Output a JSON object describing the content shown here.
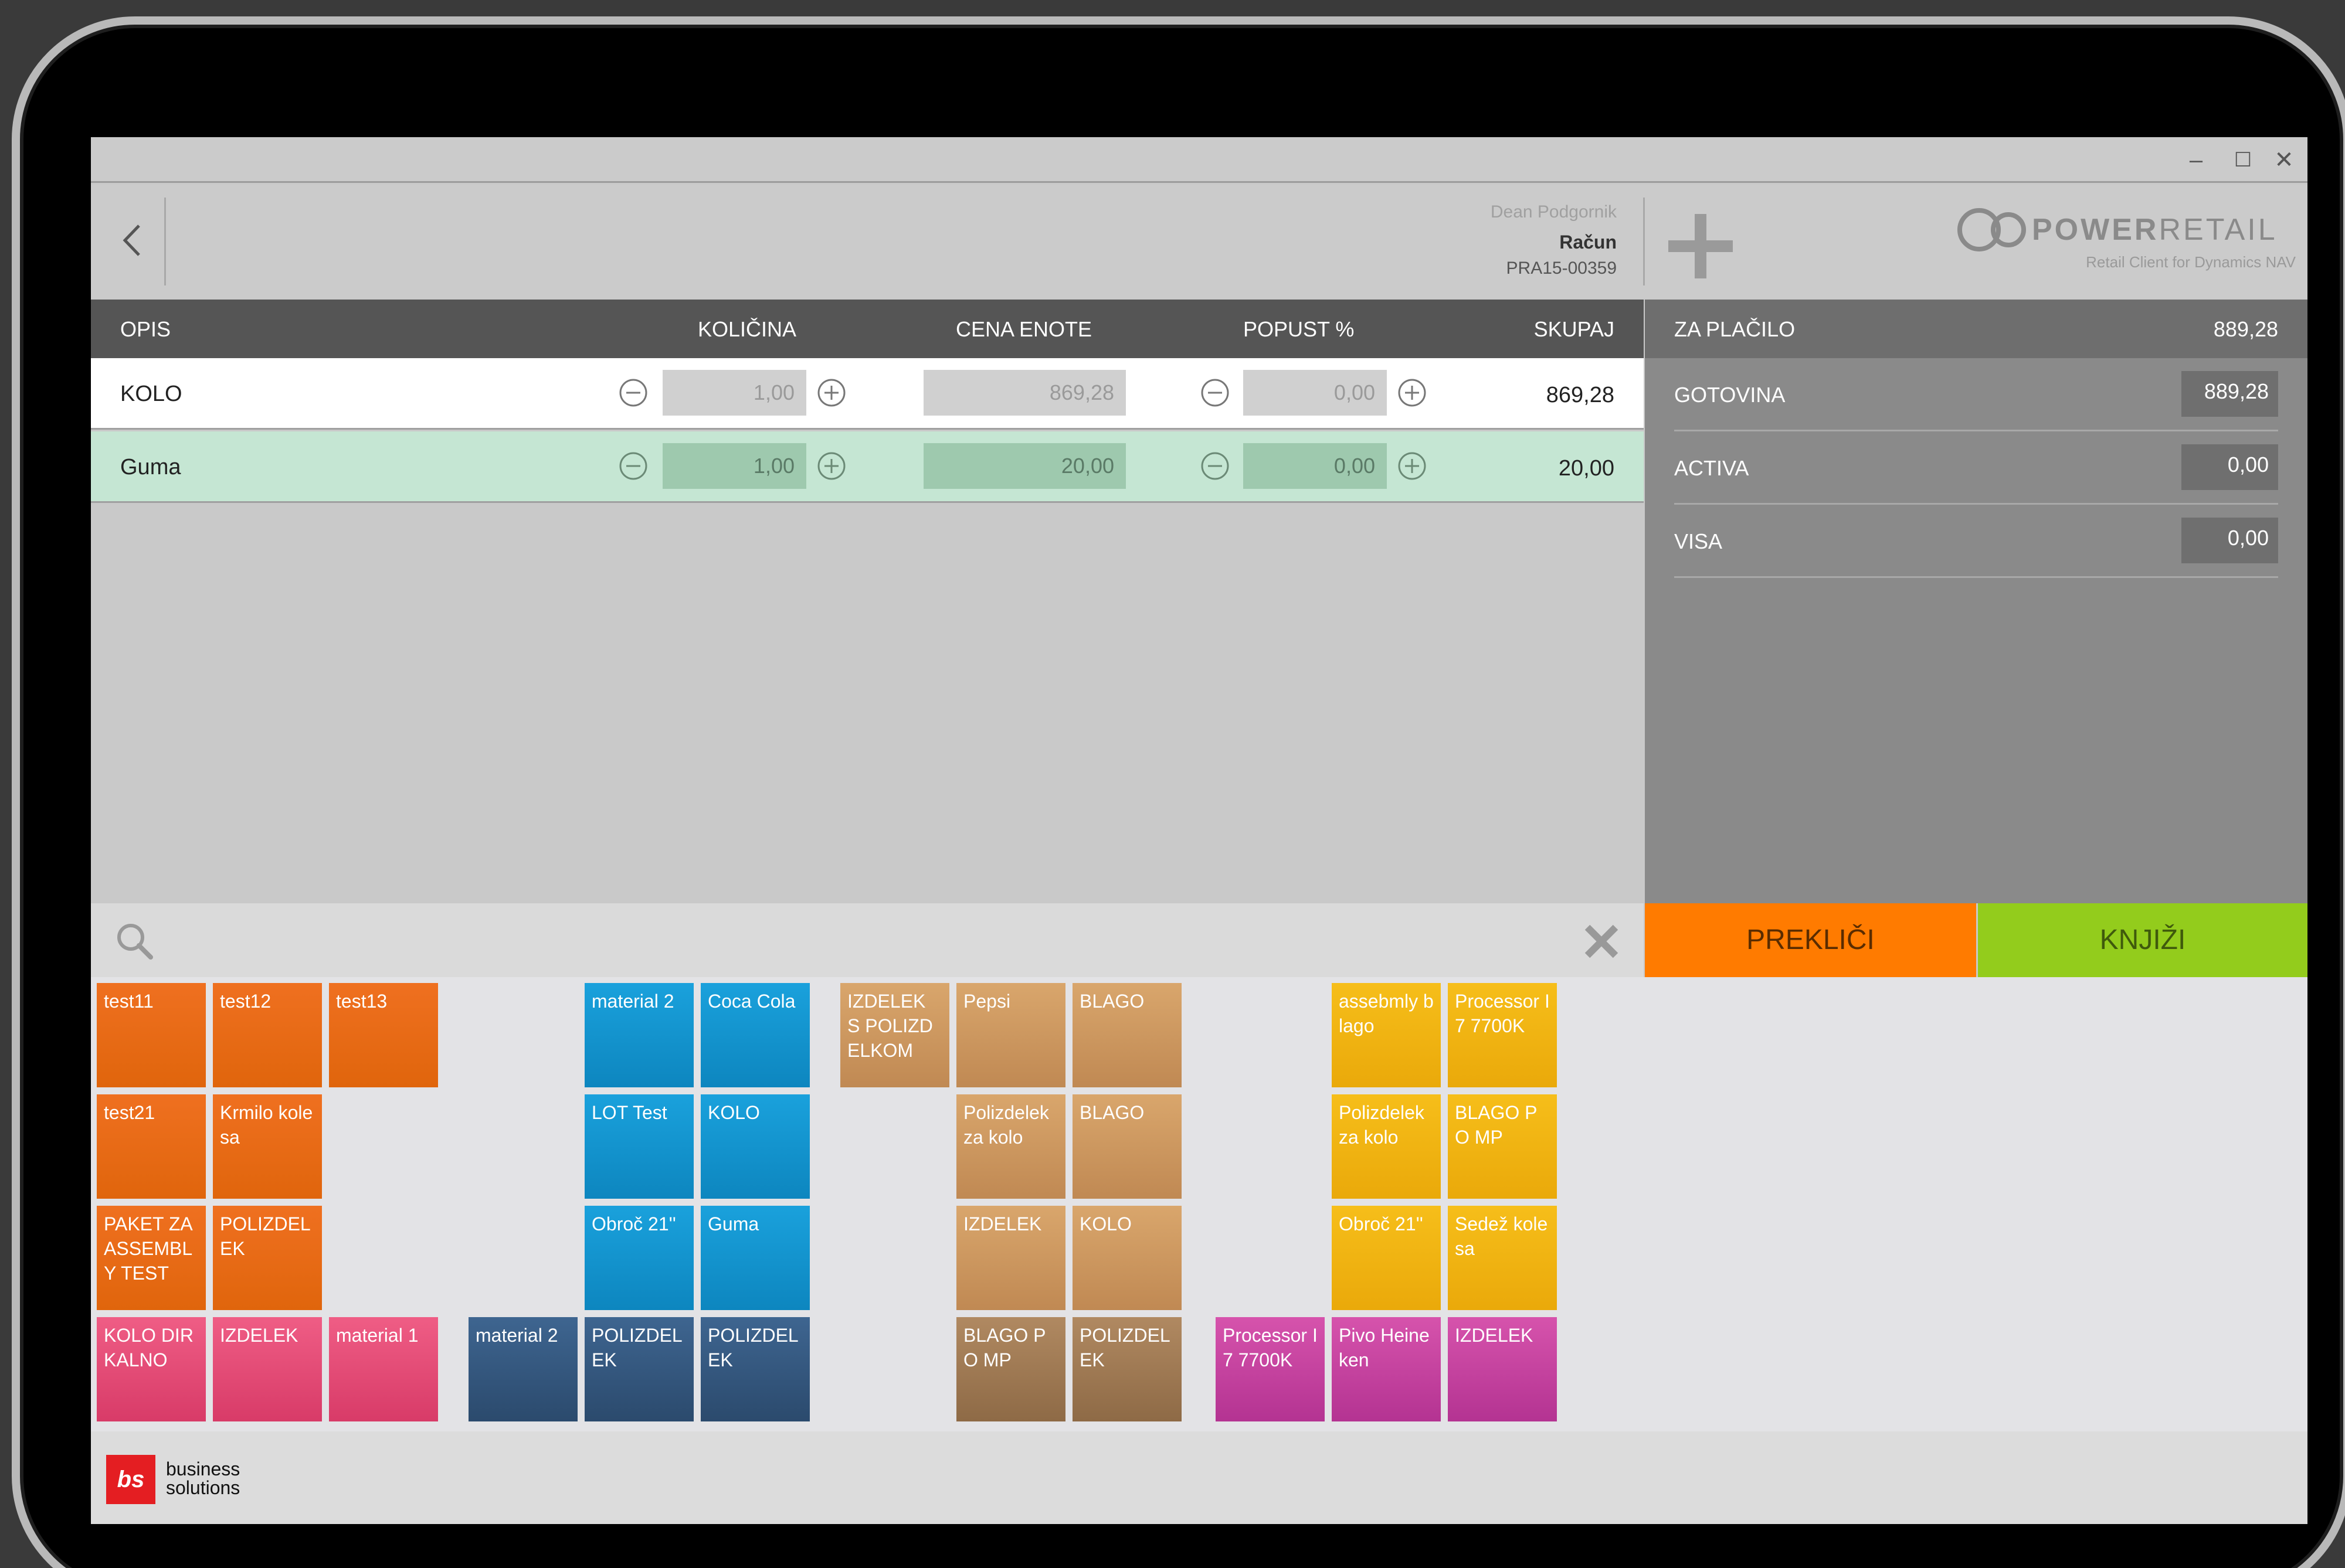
{
  "window": {
    "minimize": "–",
    "maximize": "☐",
    "close": "✕"
  },
  "header": {
    "user": "Dean Podgornik",
    "doc_type": "Račun",
    "doc_no": "PRA15-00359",
    "brand_power": "POWER",
    "brand_retail": "RETAIL",
    "brand_sub": "Retail Client for Dynamics NAV"
  },
  "table": {
    "headers": {
      "desc": "OPIS",
      "qty": "KOLIČINA",
      "price": "CENA ENOTE",
      "disc": "POPUST %",
      "total": "SKUPAJ"
    },
    "rows": [
      {
        "desc": "KOLO",
        "qty": "1,00",
        "price": "869,28",
        "disc": "0,00",
        "total": "869,28"
      },
      {
        "desc": "Guma",
        "qty": "1,00",
        "price": "20,00",
        "disc": "0,00",
        "total": "20,00"
      }
    ]
  },
  "payment": {
    "header_label": "ZA PLAČILO",
    "header_value": "889,28",
    "methods": [
      {
        "label": "GOTOVINA",
        "value": "889,28"
      },
      {
        "label": "ACTIVA",
        "value": "0,00"
      },
      {
        "label": "VISA",
        "value": "0,00"
      }
    ]
  },
  "actions": {
    "cancel": "PREKLIČI",
    "post": "KNJIŽI"
  },
  "tiles": {
    "a1": "test11",
    "a2": "test12",
    "a3": "test13",
    "a4": "test21",
    "a5": "Krmilo kolesa",
    "a6": "PAKET ZA ASSEMBLY TEST",
    "a7": "POLIZDELEK",
    "a8": "KOLO DIRKALNO",
    "a9": "IZDELEK",
    "a10": "material 1",
    "b1": "material 2",
    "b2": "material 2",
    "b3": "Coca Cola",
    "b4": "LOT Test",
    "b5": "KOLO",
    "b6": "Obroč 21''",
    "b7": "Guma",
    "b8": "POLIZDELEK",
    "b9": "POLIZDELEK",
    "c1": "IZDELEK S POLIZDELKOM",
    "c2": "Pepsi",
    "c3": "BLAGO",
    "c4": "Polizdelek za kolo",
    "c5": "BLAGO",
    "c6": "IZDELEK",
    "c7": "KOLO",
    "c8": "BLAGO PO MP",
    "c9": "POLIZDELEK",
    "d1": "assebmly blago",
    "d2": "Processor I7 7700K",
    "d3": "Polizdelek za kolo",
    "d4": "BLAGO PO MP",
    "d5": "Obroč 21''",
    "d6": "Sedež kolesa",
    "d7": "Processor I7 7700K",
    "d8": "Pivo Heineken",
    "d9": "IZDELEK"
  },
  "footer": {
    "logo": "bs",
    "line1": "business",
    "line2": "solutions"
  }
}
